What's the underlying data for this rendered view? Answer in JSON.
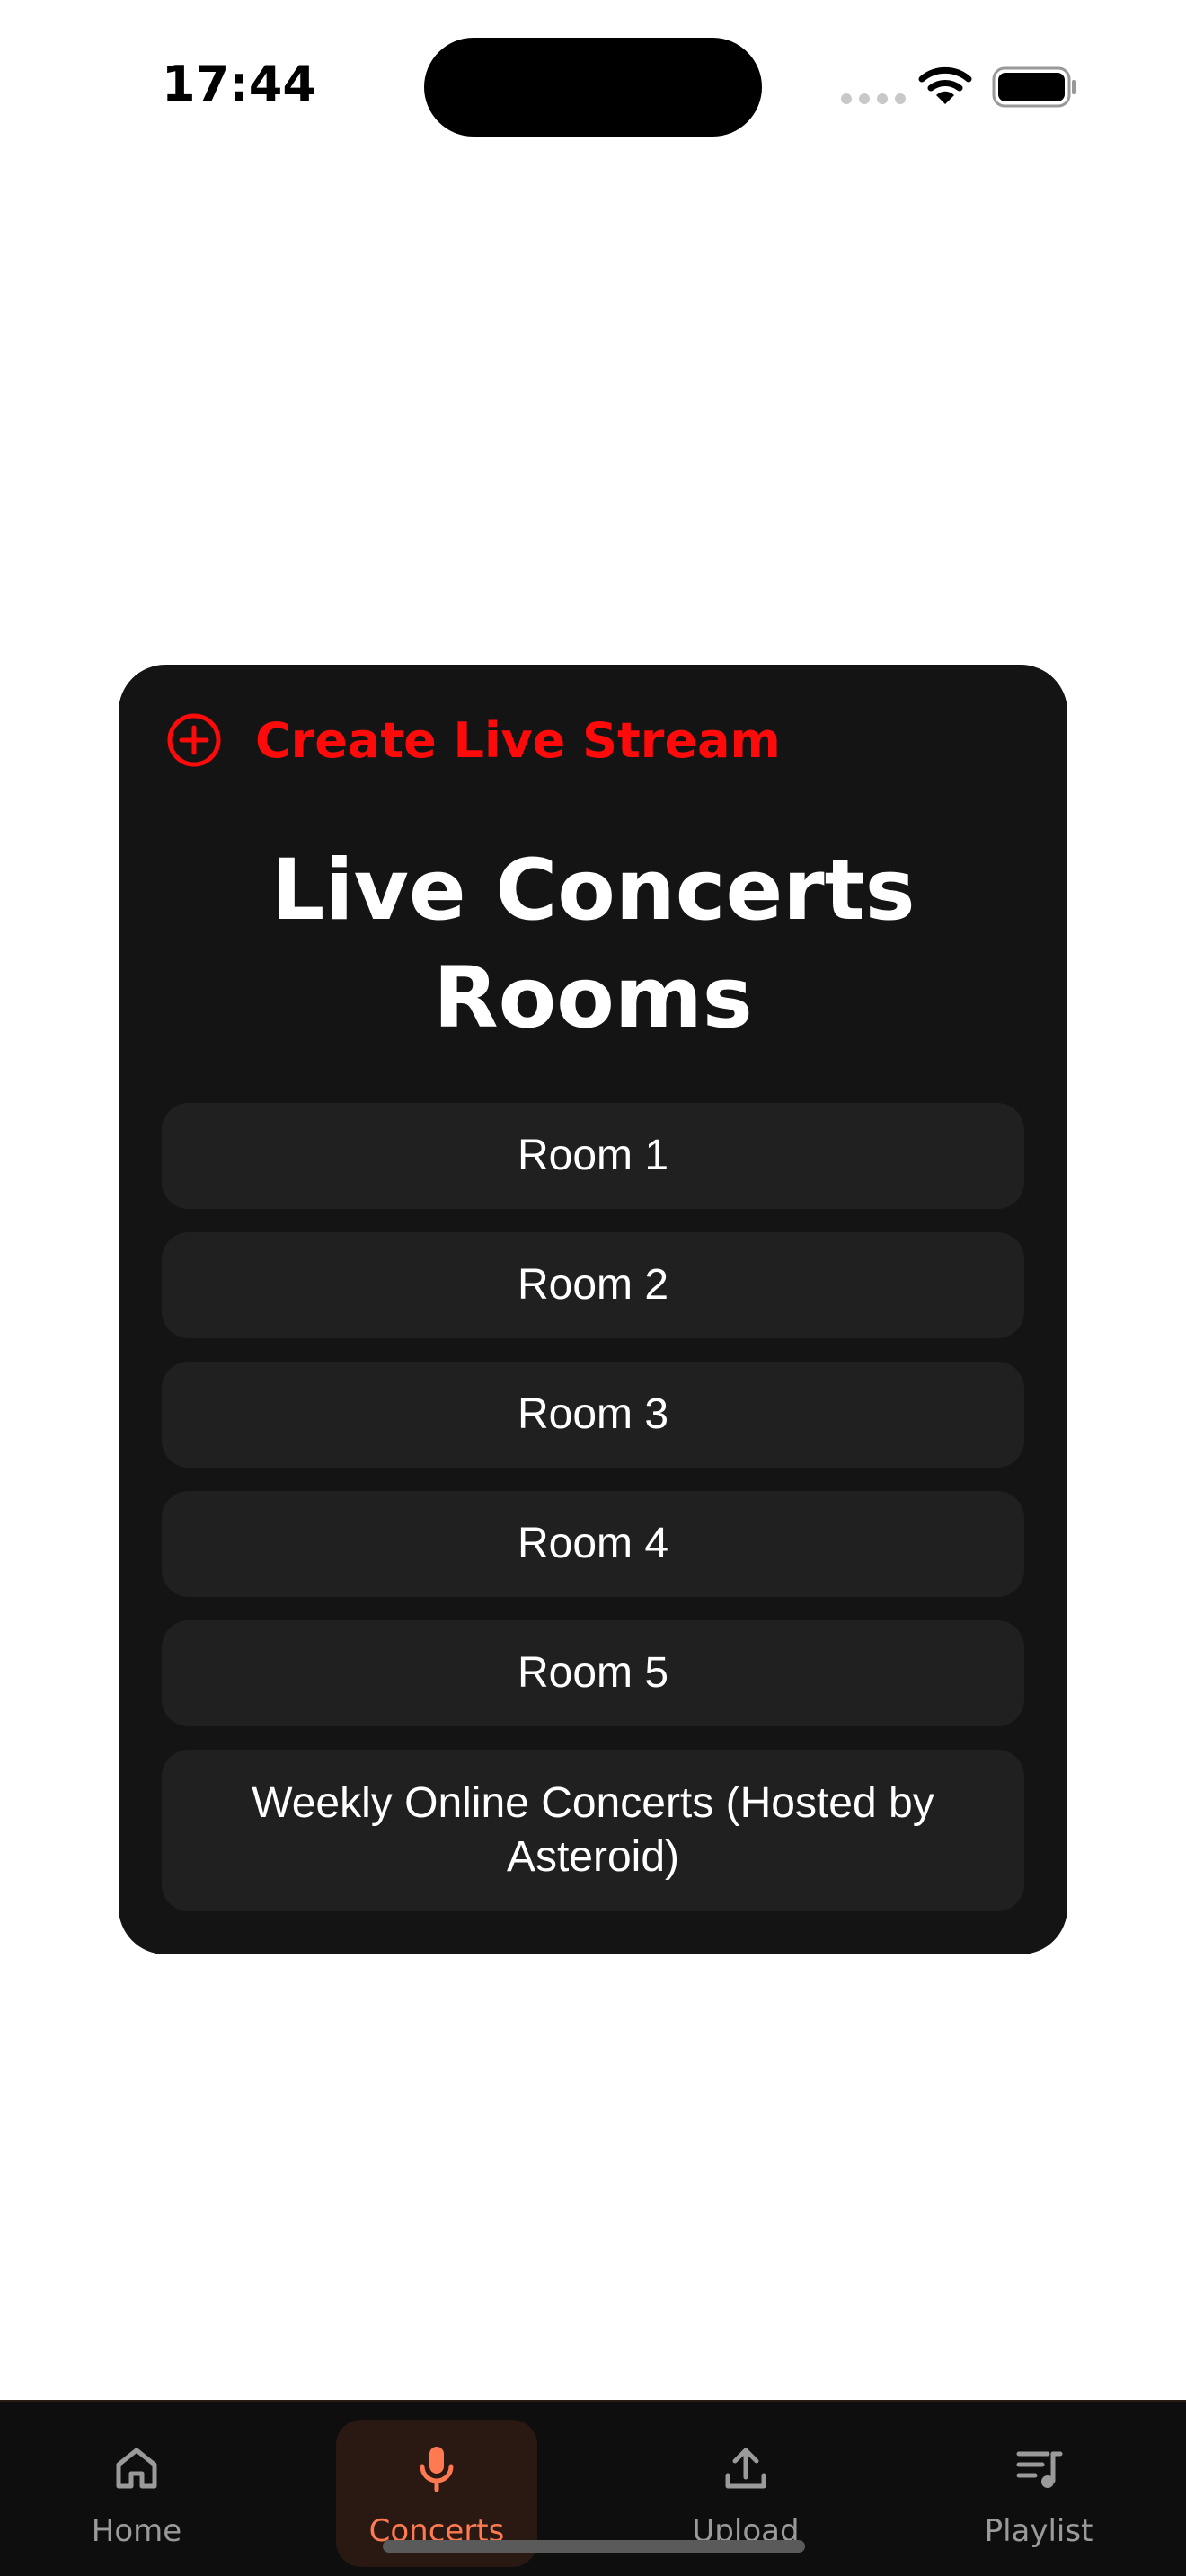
{
  "status_bar": {
    "time": "17:44"
  },
  "card": {
    "create_label": "Create Live Stream",
    "title_line1": "Live Concerts",
    "title_line2": "Rooms",
    "rooms": [
      {
        "label": "Room 1"
      },
      {
        "label": "Room 2"
      },
      {
        "label": "Room 3"
      },
      {
        "label": "Room 4"
      },
      {
        "label": "Room 5"
      },
      {
        "label": "Weekly Online Concerts (Hosted by Asteroid)"
      }
    ]
  },
  "bottom_nav": {
    "items": [
      {
        "label": "Home",
        "icon": "home-icon"
      },
      {
        "label": "Concerts",
        "icon": "microphone-icon",
        "active": true
      },
      {
        "label": "Upload",
        "icon": "upload-icon"
      },
      {
        "label": "Playlist",
        "icon": "playlist-icon"
      }
    ]
  },
  "colors": {
    "accent_red": "#ff0a0a",
    "active_nav": "#ff7a50",
    "card_bg": "#141414",
    "room_bg": "#202020"
  }
}
